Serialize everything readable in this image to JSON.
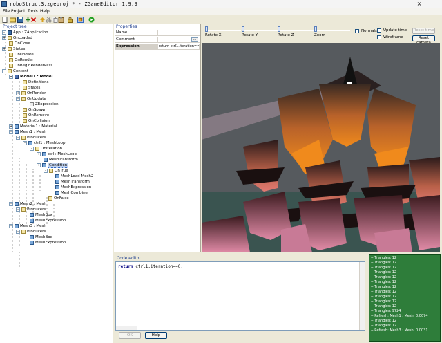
{
  "window": {
    "title": "roboStruct3.zgeproj * - ZGameEditor 1.9.9",
    "close_glyph": "×"
  },
  "menu": [
    "File",
    "Project",
    "Tools",
    "Help"
  ],
  "toolbar": {
    "icons": [
      "new-icon",
      "open-icon",
      "save-icon",
      "add-icon",
      "delete-icon",
      "move-up-icon",
      "cut-icon",
      "copy-icon",
      "paste-icon",
      "lock-icon",
      "selected-tool-icon",
      "run-icon"
    ]
  },
  "tree": {
    "caption": "Project tree",
    "items": [
      {
        "label": "App : ZApplication",
        "exp": "-"
      },
      {
        "label": "OnLoaded",
        "exp": "+"
      },
      {
        "label": "OnClose",
        "exp": ""
      },
      {
        "label": "States",
        "exp": "+"
      },
      {
        "label": "OnUpdate",
        "exp": ""
      },
      {
        "label": "OnRender",
        "exp": ""
      },
      {
        "label": "OnBeginRenderPass",
        "exp": ""
      },
      {
        "label": "Content",
        "exp": "-"
      },
      {
        "label": "Model1 : Model",
        "exp": "-"
      },
      {
        "label": "Definitions",
        "exp": ""
      },
      {
        "label": "States",
        "exp": ""
      },
      {
        "label": "OnRender",
        "exp": "+"
      },
      {
        "label": "OnUpdate",
        "exp": "-"
      },
      {
        "label": "ZExpression",
        "exp": ""
      },
      {
        "label": "OnSpawn",
        "exp": ""
      },
      {
        "label": "OnRemove",
        "exp": ""
      },
      {
        "label": "OnCollision",
        "exp": ""
      },
      {
        "label": "Material1 : Material",
        "exp": "+"
      },
      {
        "label": "Mesh1 : Mesh",
        "exp": "-"
      },
      {
        "label": "Producers",
        "exp": "-"
      },
      {
        "label": "ctrl1 : MeshLoop",
        "exp": "-"
      },
      {
        "label": "OnIteration",
        "exp": "-"
      },
      {
        "label": "ctrl : MeshLoop",
        "exp": "+"
      },
      {
        "label": "MeshTransform",
        "exp": ""
      },
      {
        "label": "Condition",
        "exp": "+"
      },
      {
        "label": "OnTrue",
        "exp": "-"
      },
      {
        "label": "MeshLoad Mesh2",
        "exp": ""
      },
      {
        "label": "MeshTransform",
        "exp": ""
      },
      {
        "label": "MeshExpression",
        "exp": ""
      },
      {
        "label": "MeshCombine",
        "exp": ""
      },
      {
        "label": "OnFalse",
        "exp": ""
      },
      {
        "label": "Mesh2 : Mesh",
        "exp": "-"
      },
      {
        "label": "Producers",
        "exp": "-"
      },
      {
        "label": "MeshBox",
        "exp": ""
      },
      {
        "label": "MeshExpression",
        "exp": ""
      },
      {
        "label": "Mesh3 : Mesh",
        "exp": "-"
      },
      {
        "label": "Producers",
        "exp": "-"
      },
      {
        "label": "MeshBox",
        "exp": ""
      },
      {
        "label": "MeshExpression",
        "exp": ""
      }
    ]
  },
  "properties": {
    "caption": "Properties",
    "rows": [
      {
        "key": "Name",
        "value": ""
      },
      {
        "key": "Comment",
        "value": ""
      },
      {
        "key": "Expression",
        "value": "return ctrl1.iteration==0;"
      }
    ],
    "browse_glyph": "..."
  },
  "view_controls": {
    "sliders": [
      "Rotate X",
      "Rotate Y",
      "Rotate Z",
      "Zoom"
    ],
    "normals_label": "Normals",
    "update_time_label": "Update time",
    "wireframe_label": "Wireframe",
    "reset_time_label": "Reset time",
    "reset_camera_label": "Reset camera"
  },
  "code_editor": {
    "caption": "Code editor",
    "keyword": "return",
    "code_rest": " ctrl1.iteration==0;",
    "ok_label": "OK",
    "help_label": "Help"
  },
  "log": {
    "lines": [
      "-- Triangles: 12",
      "-- Triangles: 12",
      "-- Triangles: 12",
      "-- Triangles: 12",
      "-- Triangles: 12",
      "-- Triangles: 12",
      "-- Triangles: 12",
      "-- Triangles: 12",
      "-- Triangles: 12",
      "-- Triangles: 12",
      "-- Triangles: 12",
      "-- Triangles: 9724",
      "-- Refresh: Mesh1 : Mesh: 0.0074",
      "-- Triangles: 12",
      "-- Triangles: 12",
      "-- Refresh: Mesh3 : Mesh: 0.0031"
    ]
  },
  "colors": {
    "selection": "#c1d2ee",
    "log_background": "#2e7d3a",
    "sky": "#565a5e",
    "floor": "#3a5450"
  }
}
